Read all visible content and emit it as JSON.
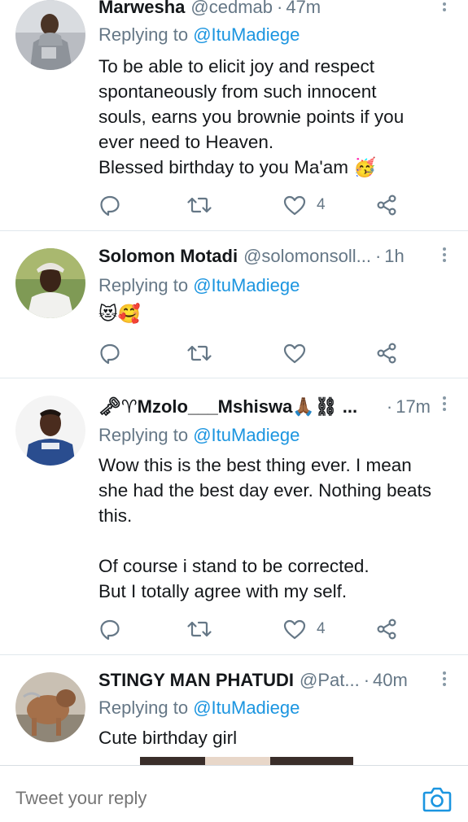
{
  "tweets": [
    {
      "name": "Marwesha",
      "handle": "@cedmab",
      "time": "47m",
      "reply_prefix": "Replying to",
      "reply_mention": "@ItuMadiege",
      "lines": [
        "To be able to elicit joy and respect",
        "spontaneously from such innocent",
        "souls, earns you brownie points if you",
        "ever need to Heaven.",
        "Blessed birthday to you Ma'am 🥳"
      ],
      "likes": "4"
    },
    {
      "name": "Solomon Motadi",
      "handle": "@solomonsoll...",
      "time": "1h",
      "reply_prefix": "Replying to",
      "reply_mention": "@ItuMadiege",
      "lines": [
        "😻🥰"
      ],
      "likes": ""
    },
    {
      "name": "🗝♈Mzolo___Mshiswa🙏🏾⛓ ...",
      "handle": "",
      "time": "17m",
      "reply_prefix": "Replying to",
      "reply_mention": "@ItuMadiege",
      "lines": [
        "Wow this is the best thing ever. I mean",
        "she had the best day ever. Nothing beats",
        "this.",
        "",
        "Of course i stand to be corrected.",
        "But I totally agree with my self."
      ],
      "likes": "4"
    },
    {
      "name": "STINGY MAN PHATUDI",
      "handle": "@Pat...",
      "time": "40m",
      "reply_prefix": "Replying to",
      "reply_mention": "@ItuMadiege",
      "lines": [
        "Cute birthday girl"
      ]
    }
  ],
  "separator": "·",
  "compose": {
    "placeholder": "Tweet your reply"
  },
  "icons": {
    "reply": "reply-icon",
    "retweet": "retweet-icon",
    "like": "heart-icon",
    "share": "share-icon",
    "more": "more-vertical-icon",
    "camera": "camera-icon"
  },
  "colors": {
    "link": "#1b95e0",
    "secondary_text": "#657786",
    "icon": "#657786",
    "divider": "#e1e8ed"
  }
}
